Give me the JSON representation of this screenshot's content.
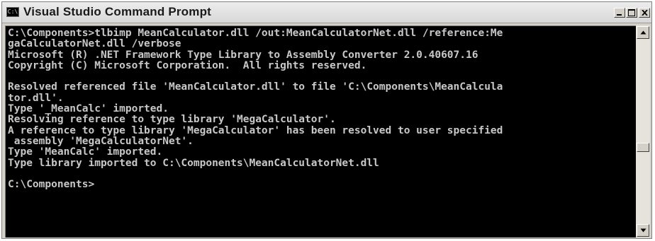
{
  "window": {
    "title": "Visual Studio Command Prompt",
    "icon_label": "C:\\"
  },
  "controls": {
    "minimize": "minimize-icon",
    "maximize": "maximize-icon",
    "close": "close-icon"
  },
  "console": {
    "text": "C:\\Components>tlbimp MeanCalculator.dll /out:MeanCalculatorNet.dll /reference:Me\ngaCalculatorNet.dll /verbose\nMicrosoft (R) .NET Framework Type Library to Assembly Converter 2.0.40607.16\nCopyright (C) Microsoft Corporation.  All rights reserved.\n\nResolved referenced file 'MeanCalculator.dll' to file 'C:\\Components\\MeanCalcula\ntor.dll'.\nType '_MeanCalc' imported.\nResolving reference to type library 'MegaCalculator'.\nA reference to type library 'MegaCalculator' has been resolved to user specified\n assembly 'MegaCalculatorNet'.\nType 'MeanCalc' imported.\nType library imported to C:\\Components\\MeanCalculatorNet.dll\n\nC:\\Components>"
  },
  "scrollbar": {
    "up": "scroll-up-arrow-icon",
    "down": "scroll-down-arrow-icon"
  }
}
